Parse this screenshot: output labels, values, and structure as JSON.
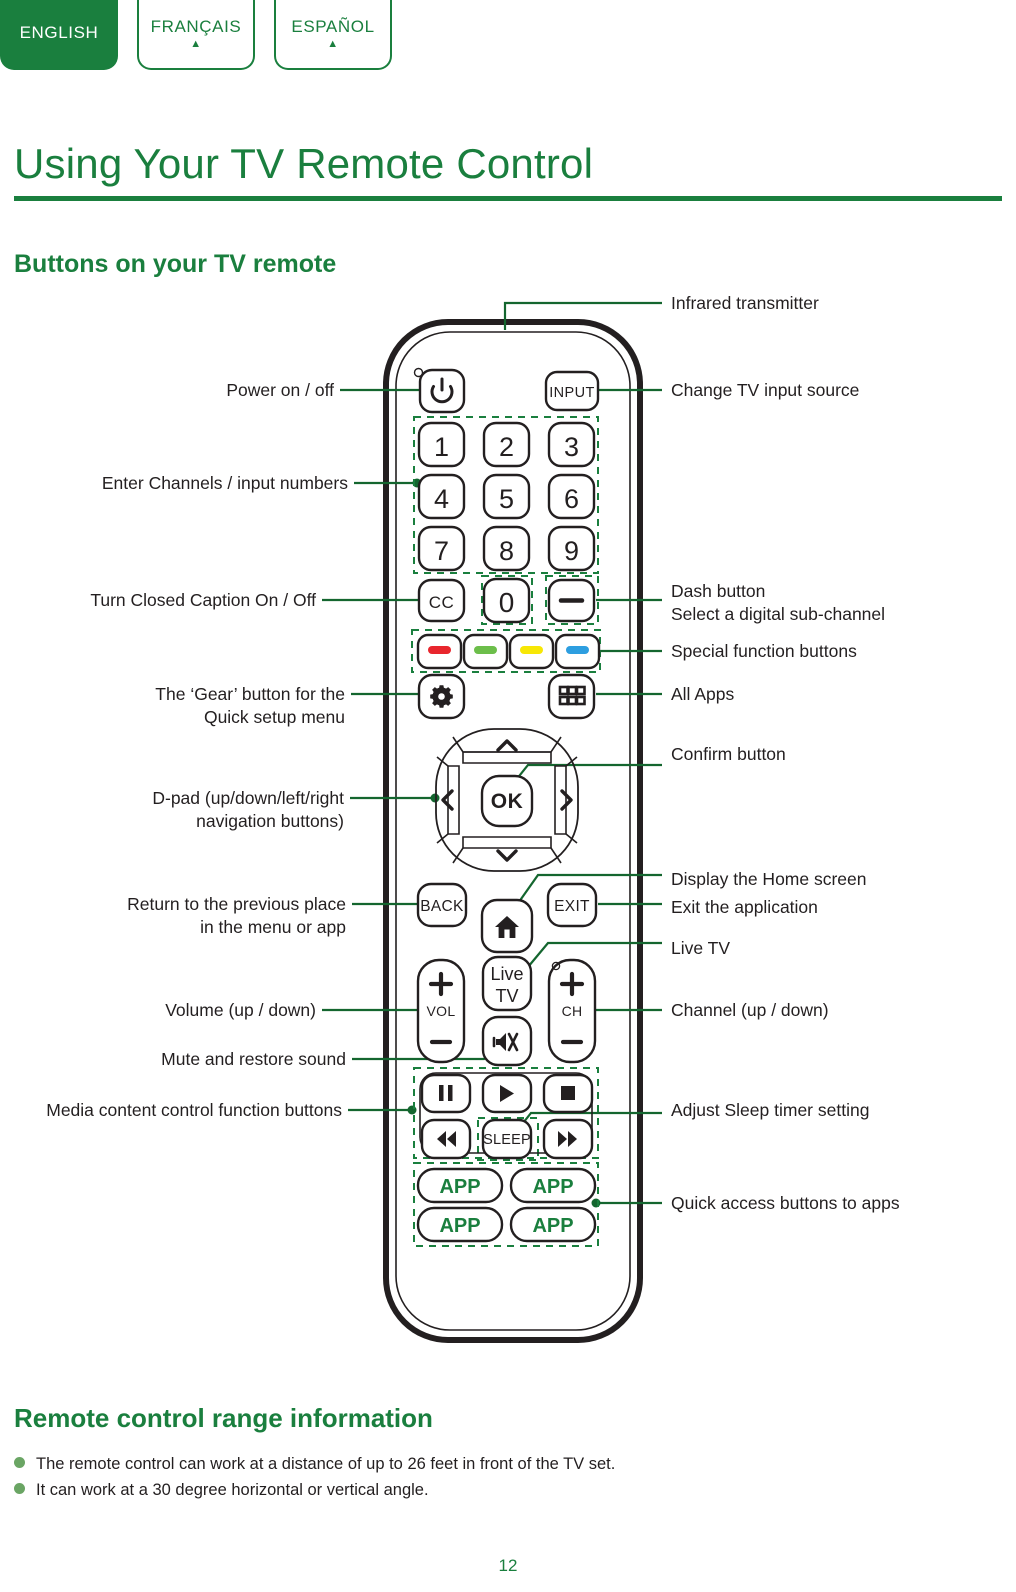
{
  "colors": {
    "brand_green": "#1a7f3e",
    "text_dark": "#231f20",
    "bullet_green": "#6aa564",
    "fn_red": "#e8262d",
    "fn_green": "#6cbe4a",
    "fn_yellow": "#f7e705",
    "fn_blue": "#2d9ee0"
  },
  "lang_tabs": [
    {
      "label": "ENGLISH",
      "active": true,
      "caret": ""
    },
    {
      "label": "FRANÇAIS",
      "active": false,
      "caret": "▲"
    },
    {
      "label": "ESPAÑOL",
      "active": false,
      "caret": "▲"
    }
  ],
  "page": {
    "title": "Using Your TV Remote Control",
    "section_heading": "Buttons on your TV remote",
    "number": "12"
  },
  "range_section": {
    "heading": "Remote control range information",
    "bullets": [
      "The remote control can work at a distance of up to 26 feet in front of the TV set.",
      "It can work at a 30 degree horizontal or vertical angle."
    ]
  },
  "callouts": {
    "left": [
      {
        "name": "power-on-off",
        "text": "Power on / off"
      },
      {
        "name": "enter-channels",
        "text": "Enter Channels / input numbers"
      },
      {
        "name": "closed-caption",
        "text": "Turn Closed Caption On / Off"
      },
      {
        "name": "gear-quick-setup",
        "text": "The ‘Gear’ button for the\nQuick setup menu"
      },
      {
        "name": "d-pad",
        "text": "D-pad (up/down/left/right\nnavigation buttons)"
      },
      {
        "name": "back-return",
        "text": "Return to the previous place\nin the menu or app"
      },
      {
        "name": "volume-up-down",
        "text": "Volume (up / down)"
      },
      {
        "name": "mute-restore",
        "text": "Mute and restore sound"
      },
      {
        "name": "media-control",
        "text": "Media content control function buttons"
      }
    ],
    "right": [
      {
        "name": "infrared-transmitter",
        "text": "Infrared transmitter"
      },
      {
        "name": "change-tv-input",
        "text": "Change TV input source"
      },
      {
        "name": "dash-button",
        "text": "Dash button\nSelect a digital sub-channel"
      },
      {
        "name": "special-function",
        "text": "Special function buttons"
      },
      {
        "name": "all-apps",
        "text": "All Apps"
      },
      {
        "name": "confirm-button",
        "text": "Confirm button"
      },
      {
        "name": "home-screen",
        "text": "Display the Home screen"
      },
      {
        "name": "exit-application",
        "text": "Exit the application"
      },
      {
        "name": "live-tv",
        "text": "Live TV"
      },
      {
        "name": "channel-up-down",
        "text": "Channel (up / down)"
      },
      {
        "name": "sleep-timer",
        "text": "Adjust Sleep timer setting"
      },
      {
        "name": "quick-access-apps",
        "text": "Quick access buttons to apps"
      }
    ]
  },
  "remote_buttons": {
    "power": "⏻",
    "input": "INPUT",
    "numbers": [
      "1",
      "2",
      "3",
      "4",
      "5",
      "6",
      "7",
      "8",
      "9"
    ],
    "cc": "CC",
    "zero": "0",
    "dash": "—",
    "color_keys": [
      "red",
      "green",
      "yellow",
      "blue"
    ],
    "gear": "gear",
    "all_apps": "grid",
    "dpad": {
      "up": "⌃",
      "down": "⌄",
      "left": "‹",
      "right": "›",
      "ok": "OK"
    },
    "back": "BACK",
    "exit": "EXIT",
    "home": "home",
    "live_tv": [
      "Live",
      "TV"
    ],
    "vol": {
      "plus": "+",
      "label": "VOL",
      "minus": "—"
    },
    "ch": {
      "plus": "+",
      "label": "CH",
      "minus": "—"
    },
    "mute": "mute",
    "media": [
      "pause",
      "play",
      "stop",
      "rewind",
      "SLEEP",
      "fast-forward"
    ],
    "sleep": "SLEEP",
    "apps": [
      "APP",
      "APP",
      "APP",
      "APP"
    ]
  }
}
